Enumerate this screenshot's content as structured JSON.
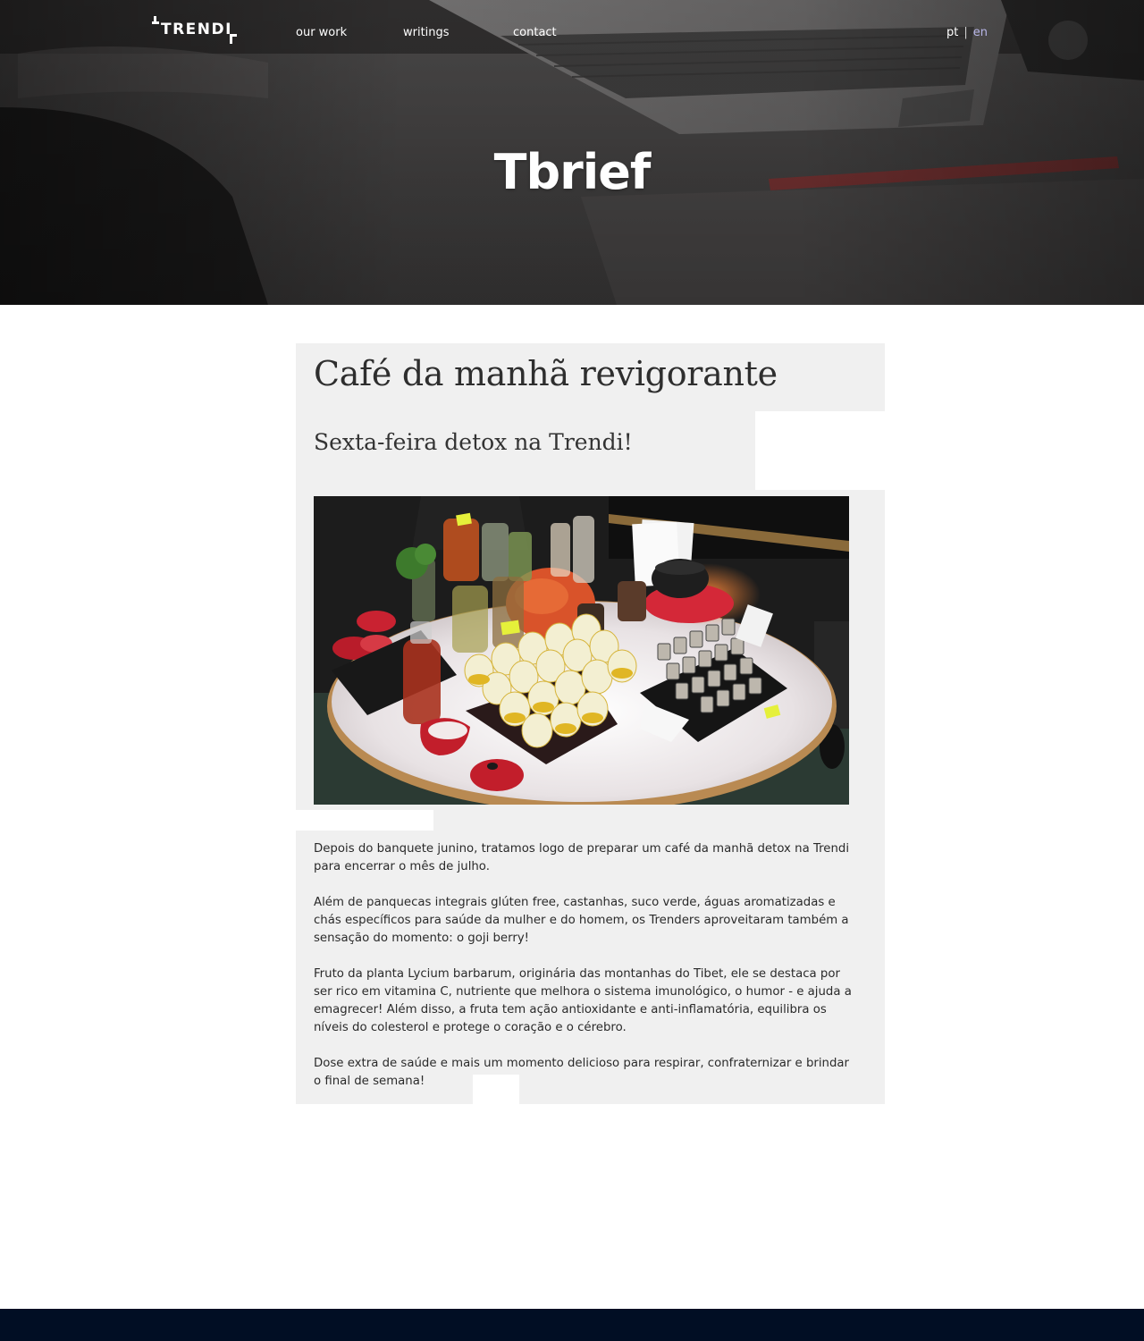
{
  "header": {
    "logo_text": "TRENDI",
    "nav": [
      {
        "label": "our work"
      },
      {
        "label": "writings"
      },
      {
        "label": "contact"
      }
    ],
    "lang": {
      "pt": "pt",
      "separator": "|",
      "en": "en"
    }
  },
  "hero": {
    "title": "Tbrief"
  },
  "article": {
    "title": "Café da manhã revigorante",
    "subtitle": "Sexta-feira detox na Trendi!",
    "paragraphs": [
      "Depois do banquete junino, tratamos logo de preparar um café da manhã detox na Trendi para encerrar o mês de julho.",
      "Além de panquecas integrais glúten free, castanhas, suco verde, águas aromatizadas e chás específicos para saúde da mulher e do homem, os Trenders aproveitaram também a sensação do momento: o goji berry!",
      "Fruto da planta Lycium barbarum, originária das montanhas do Tibet, ele se destaca por ser rico em vitamina C, nutriente que melhora o sistema imunológico, o humor - e ajuda a emagrecer! Além disso, a fruta tem ação antioxidante e anti-inflamatória, equilibra os níveis do colesterol e protege o coração e o cérebro.",
      "Dose extra de saúde e mais um momento delicioso para respirar, confraternizar e brindar o final de semana!"
    ]
  },
  "colors": {
    "article_bg": "#f0f0f0",
    "footer_bg": "#010e24",
    "lang_en": "#b8b6e8"
  }
}
